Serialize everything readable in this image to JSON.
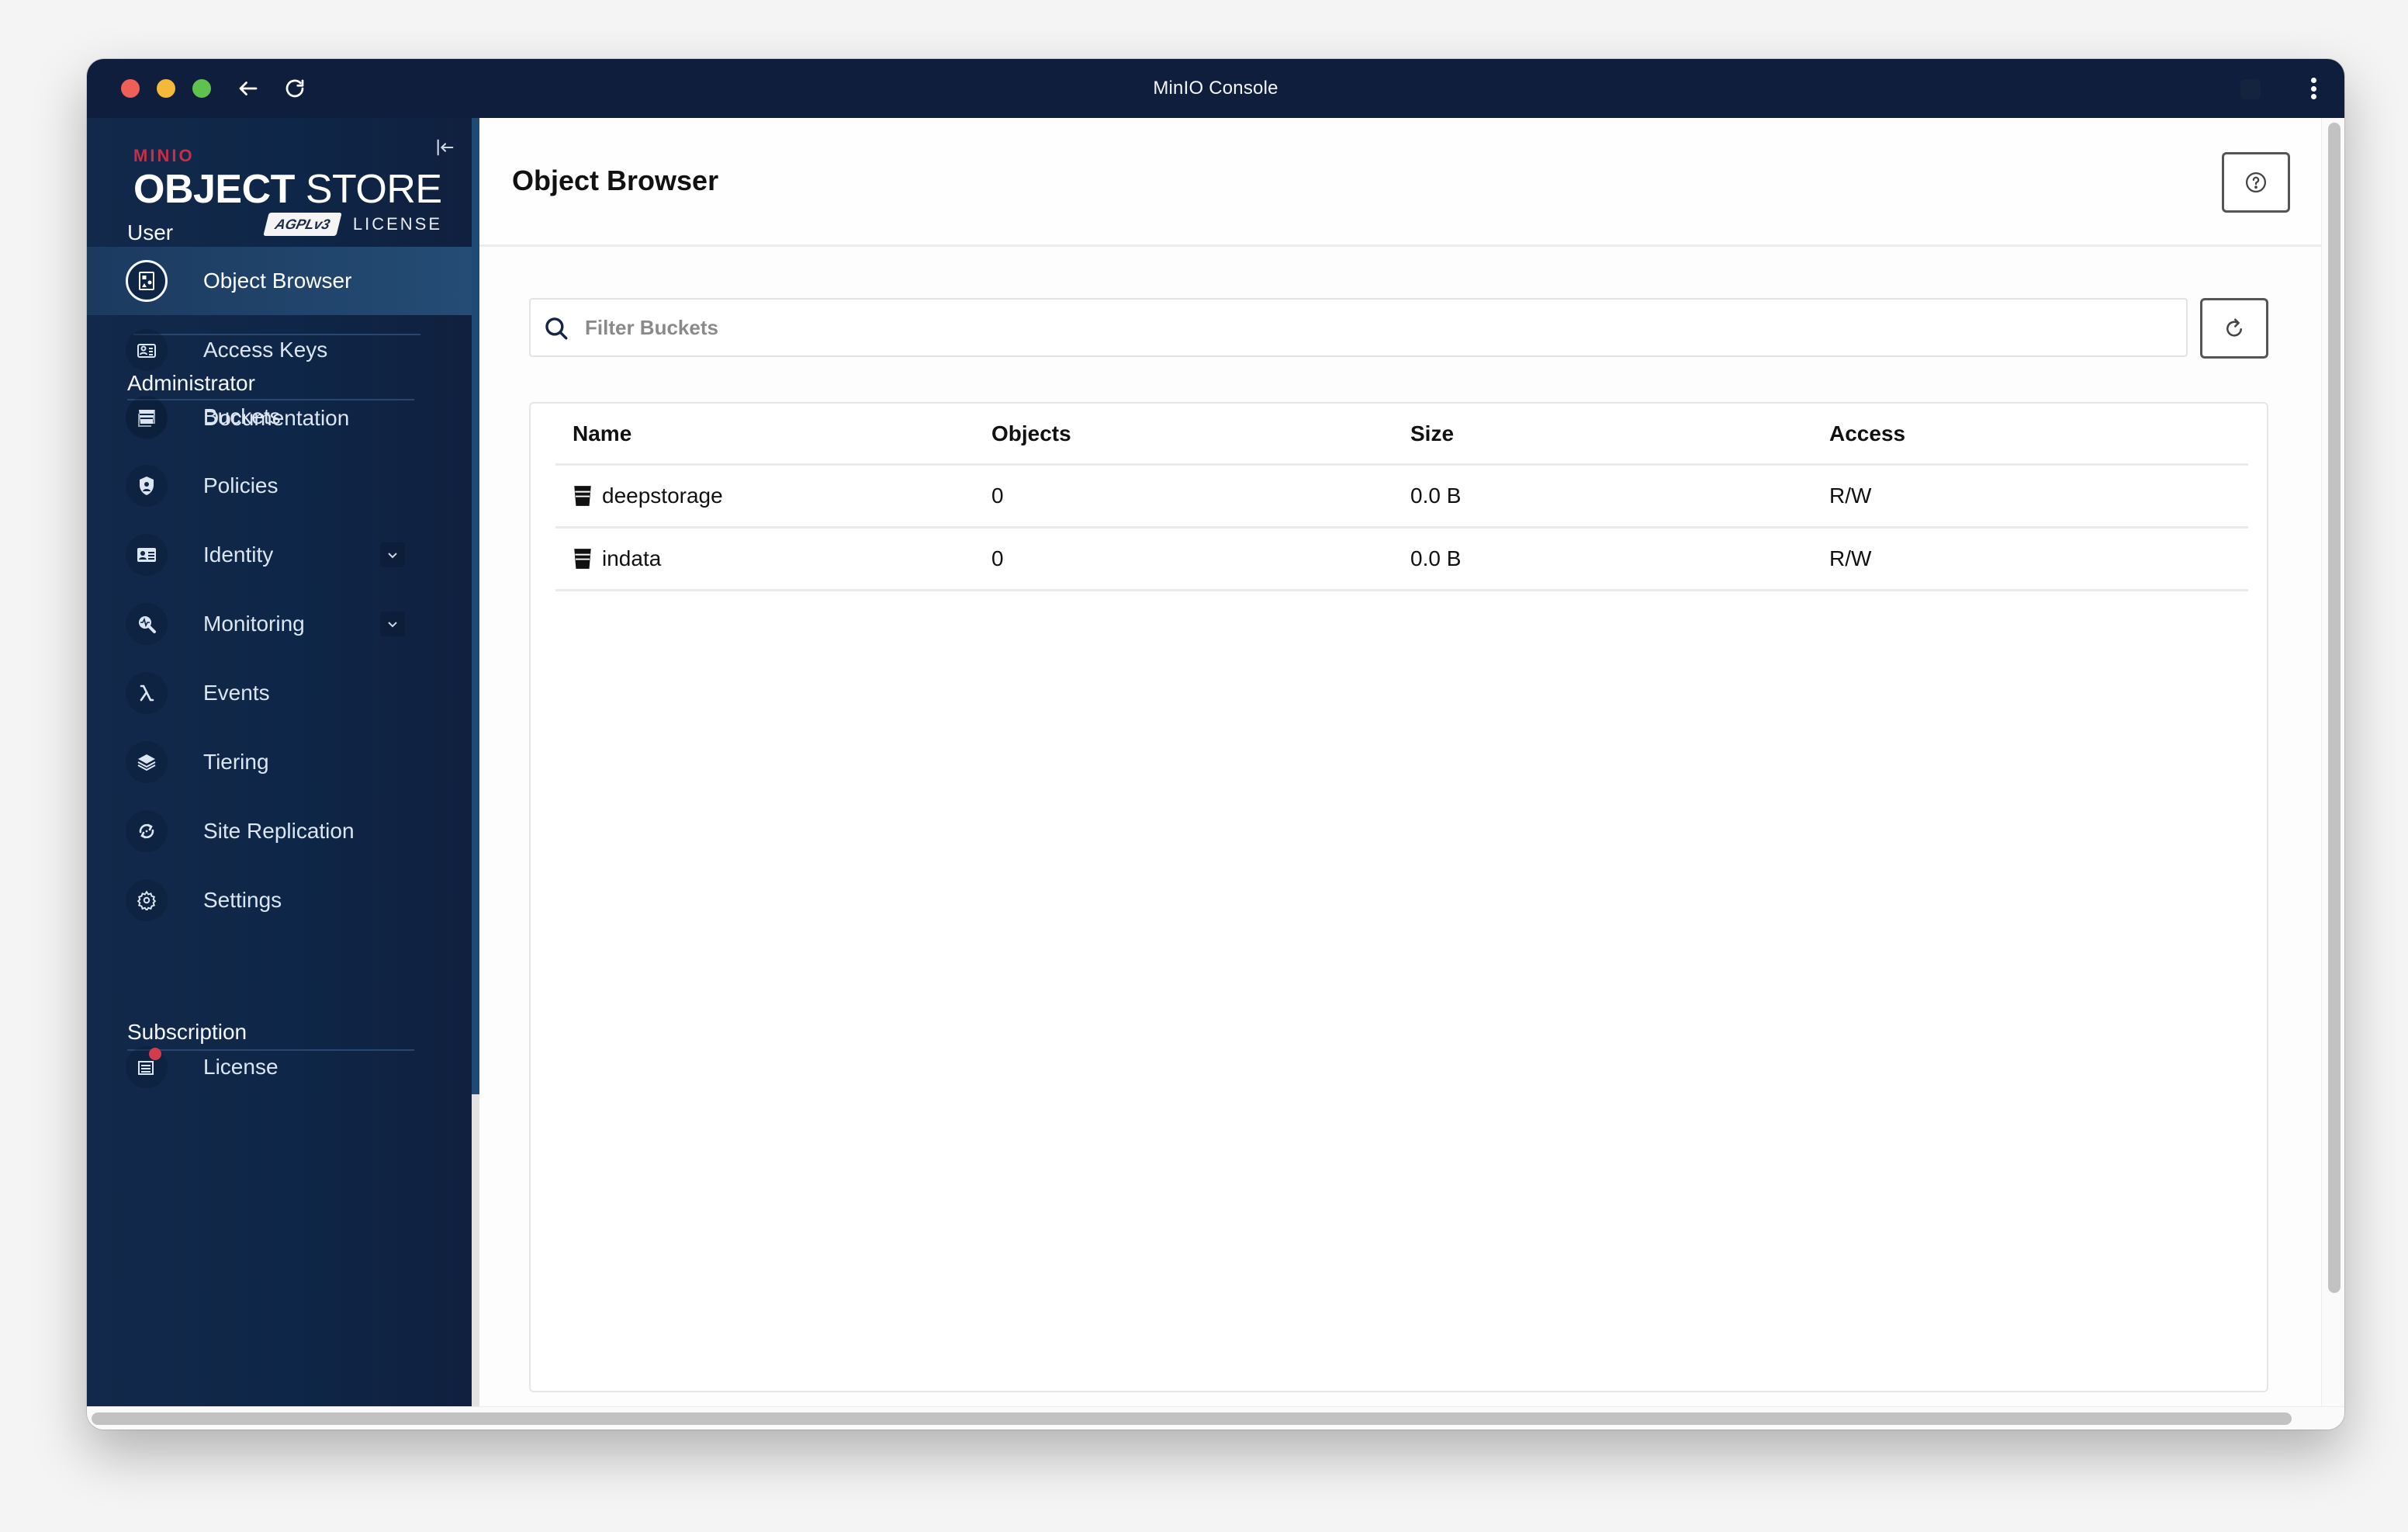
{
  "window": {
    "title": "MinIO Console"
  },
  "sidebar": {
    "logo": {
      "brand": "MINIO",
      "product_bold": "OBJECT",
      "product_light": "STORE",
      "license_badge": "AGPLv3",
      "license_word": "LICENSE"
    },
    "sections": [
      {
        "label": "User",
        "items": [
          {
            "label": "Object Browser",
            "icon": "object-browser-icon",
            "active": true
          },
          {
            "label": "Access Keys",
            "icon": "access-keys-icon"
          },
          {
            "label": "Documentation",
            "icon": "documentation-icon"
          }
        ]
      },
      {
        "label": "Administrator",
        "items": [
          {
            "label": "Buckets",
            "icon": "bucket-icon"
          },
          {
            "label": "Policies",
            "icon": "policies-shield-icon"
          },
          {
            "label": "Identity",
            "icon": "identity-card-icon",
            "expandable": true
          },
          {
            "label": "Monitoring",
            "icon": "monitoring-search-icon",
            "expandable": true
          },
          {
            "label": "Events",
            "icon": "lambda-icon"
          },
          {
            "label": "Tiering",
            "icon": "layers-icon"
          },
          {
            "label": "Site Replication",
            "icon": "sync-icon"
          },
          {
            "label": "Settings",
            "icon": "gear-icon"
          }
        ]
      },
      {
        "label": "Subscription",
        "items": [
          {
            "label": "License",
            "icon": "license-icon",
            "notification_dot": true
          }
        ]
      }
    ]
  },
  "main": {
    "title": "Object Browser",
    "filter": {
      "placeholder": "Filter Buckets",
      "value": ""
    },
    "table": {
      "columns": [
        "Name",
        "Objects",
        "Size",
        "Access"
      ],
      "rows": [
        {
          "name": "deepstorage",
          "objects": "0",
          "size": "0.0 B",
          "access": "R/W"
        },
        {
          "name": "indata",
          "objects": "0",
          "size": "0.0 B",
          "access": "R/W"
        }
      ]
    }
  },
  "colors": {
    "titlebar": "#0f1e3d",
    "sidebar": "#0e2647",
    "sidebar_active": "#244c74",
    "brand_red": "#c72e49",
    "notification": "#d23c4c"
  }
}
